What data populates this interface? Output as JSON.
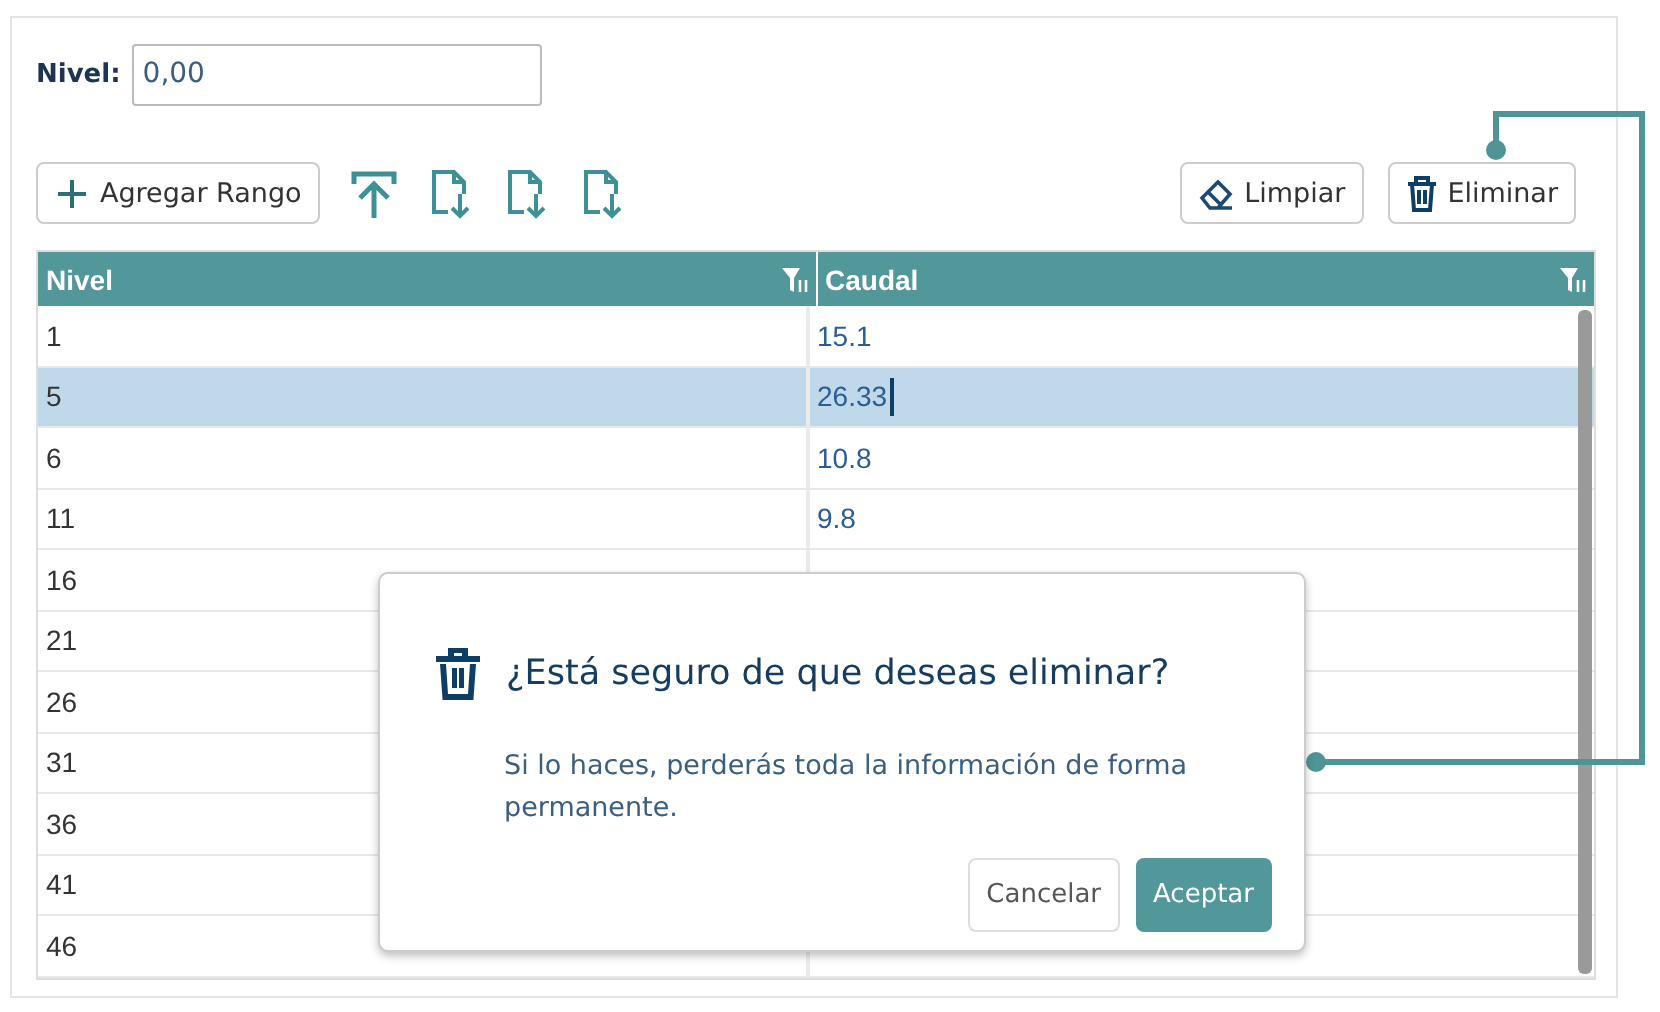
{
  "level_field": {
    "label": "Nivel:",
    "value": "0,00"
  },
  "toolbar": {
    "add_button": "Agregar Rango",
    "clear_button": "Limpiar",
    "delete_button": "Eliminar"
  },
  "table": {
    "columns": [
      "Nivel",
      "Caudal"
    ],
    "rows": [
      {
        "nivel": "1",
        "caudal": "15.1",
        "selected": false,
        "editing": false
      },
      {
        "nivel": "5",
        "caudal": "26.33",
        "selected": true,
        "editing": true
      },
      {
        "nivel": "6",
        "caudal": "10.8",
        "selected": false,
        "editing": false
      },
      {
        "nivel": "11",
        "caudal": "9.8",
        "selected": false,
        "editing": false
      },
      {
        "nivel": "16",
        "selected": false,
        "editing": false
      },
      {
        "nivel": "21",
        "selected": false,
        "editing": false
      },
      {
        "nivel": "26",
        "selected": false,
        "editing": false
      },
      {
        "nivel": "31",
        "selected": false,
        "editing": false
      },
      {
        "nivel": "36",
        "selected": false,
        "editing": false
      },
      {
        "nivel": "41",
        "selected": false,
        "editing": false
      },
      {
        "nivel": "46",
        "selected": false,
        "editing": false
      }
    ]
  },
  "dialog": {
    "title": "¿Está seguro de que deseas eliminar?",
    "message": "Si lo haces, perderás toda la información de forma permanente.",
    "buttons": [
      {
        "label": "Cancelar",
        "kind": "secondary"
      },
      {
        "label": "Aceptar",
        "kind": "primary"
      }
    ]
  }
}
